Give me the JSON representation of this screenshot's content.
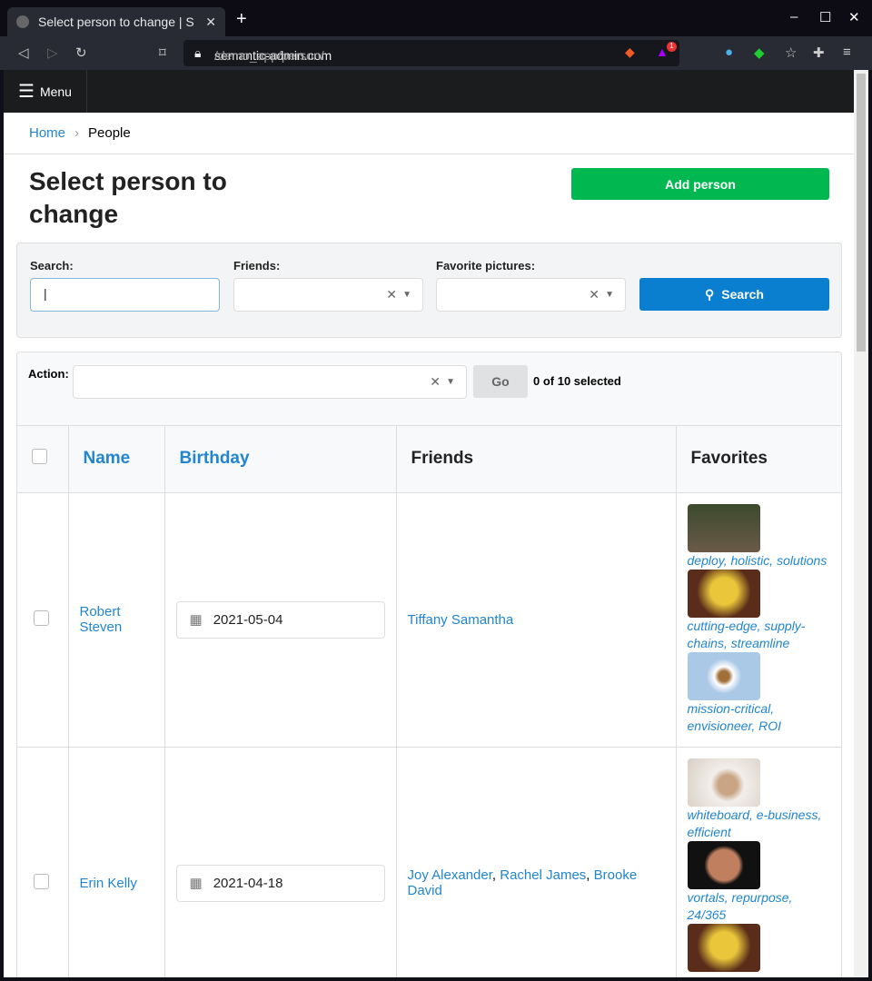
{
  "browser": {
    "tab_title": "Select person to change | S",
    "url_host": "semantic-admin.com",
    "url_path": "/demo_app/person/",
    "badge": "1"
  },
  "nav": {
    "menu_label": "Menu"
  },
  "breadcrumb": {
    "home": "Home",
    "current": "People"
  },
  "page": {
    "title": "Select person to change",
    "add_button": "Add person"
  },
  "filters": {
    "search_label": "Search:",
    "search_value": "",
    "friends_label": "Friends:",
    "favorites_label": "Favorite pictures:",
    "search_button": "Search"
  },
  "actions": {
    "label": "Action:",
    "go_button": "Go",
    "selected": "0 of 10 selected"
  },
  "table": {
    "headers": [
      "Name",
      "Birthday",
      "Friends",
      "Favorites"
    ],
    "rows": [
      {
        "name": "Robert Steven",
        "birthday": "2021-05-04",
        "friends": [
          "Tiffany Samantha"
        ],
        "favorites": [
          "deploy, holistic, solutions",
          "cutting-edge, supply-chains, streamline",
          "mission-critical, envisioneer, ROI"
        ]
      },
      {
        "name": "Erin Kelly",
        "birthday": "2021-04-18",
        "friends": [
          "Joy Alexander",
          "Rachel James",
          "Brooke David"
        ],
        "favorites": [
          "whiteboard, e-business, efficient",
          "vortals, repurpose, 24/365",
          ""
        ]
      }
    ]
  }
}
